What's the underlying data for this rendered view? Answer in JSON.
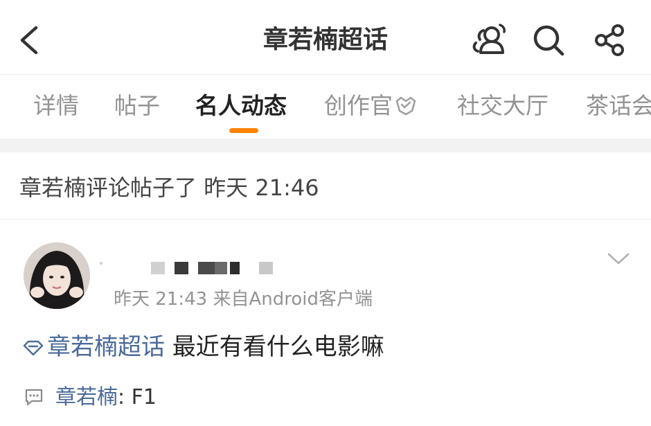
{
  "header": {
    "title": "章若楠超话"
  },
  "tabs": [
    {
      "label": "详情"
    },
    {
      "label": "帖子"
    },
    {
      "label": "名人动态"
    },
    {
      "label": "创作官"
    },
    {
      "label": "社交大厅"
    },
    {
      "label": "茶话会"
    }
  ],
  "activity": {
    "text": "章若楠评论帖子了 昨天 21:46"
  },
  "post": {
    "meta": "昨天 21:43  来自Android客户端",
    "topic": "章若楠超话",
    "text": "最近有看什么电影嘛"
  },
  "comment": {
    "author": "章若楠",
    "separator": ": ",
    "text": "F1"
  },
  "colors": {
    "accent": "#ff8200",
    "link": "#4a6a9a",
    "muted": "#939393"
  }
}
